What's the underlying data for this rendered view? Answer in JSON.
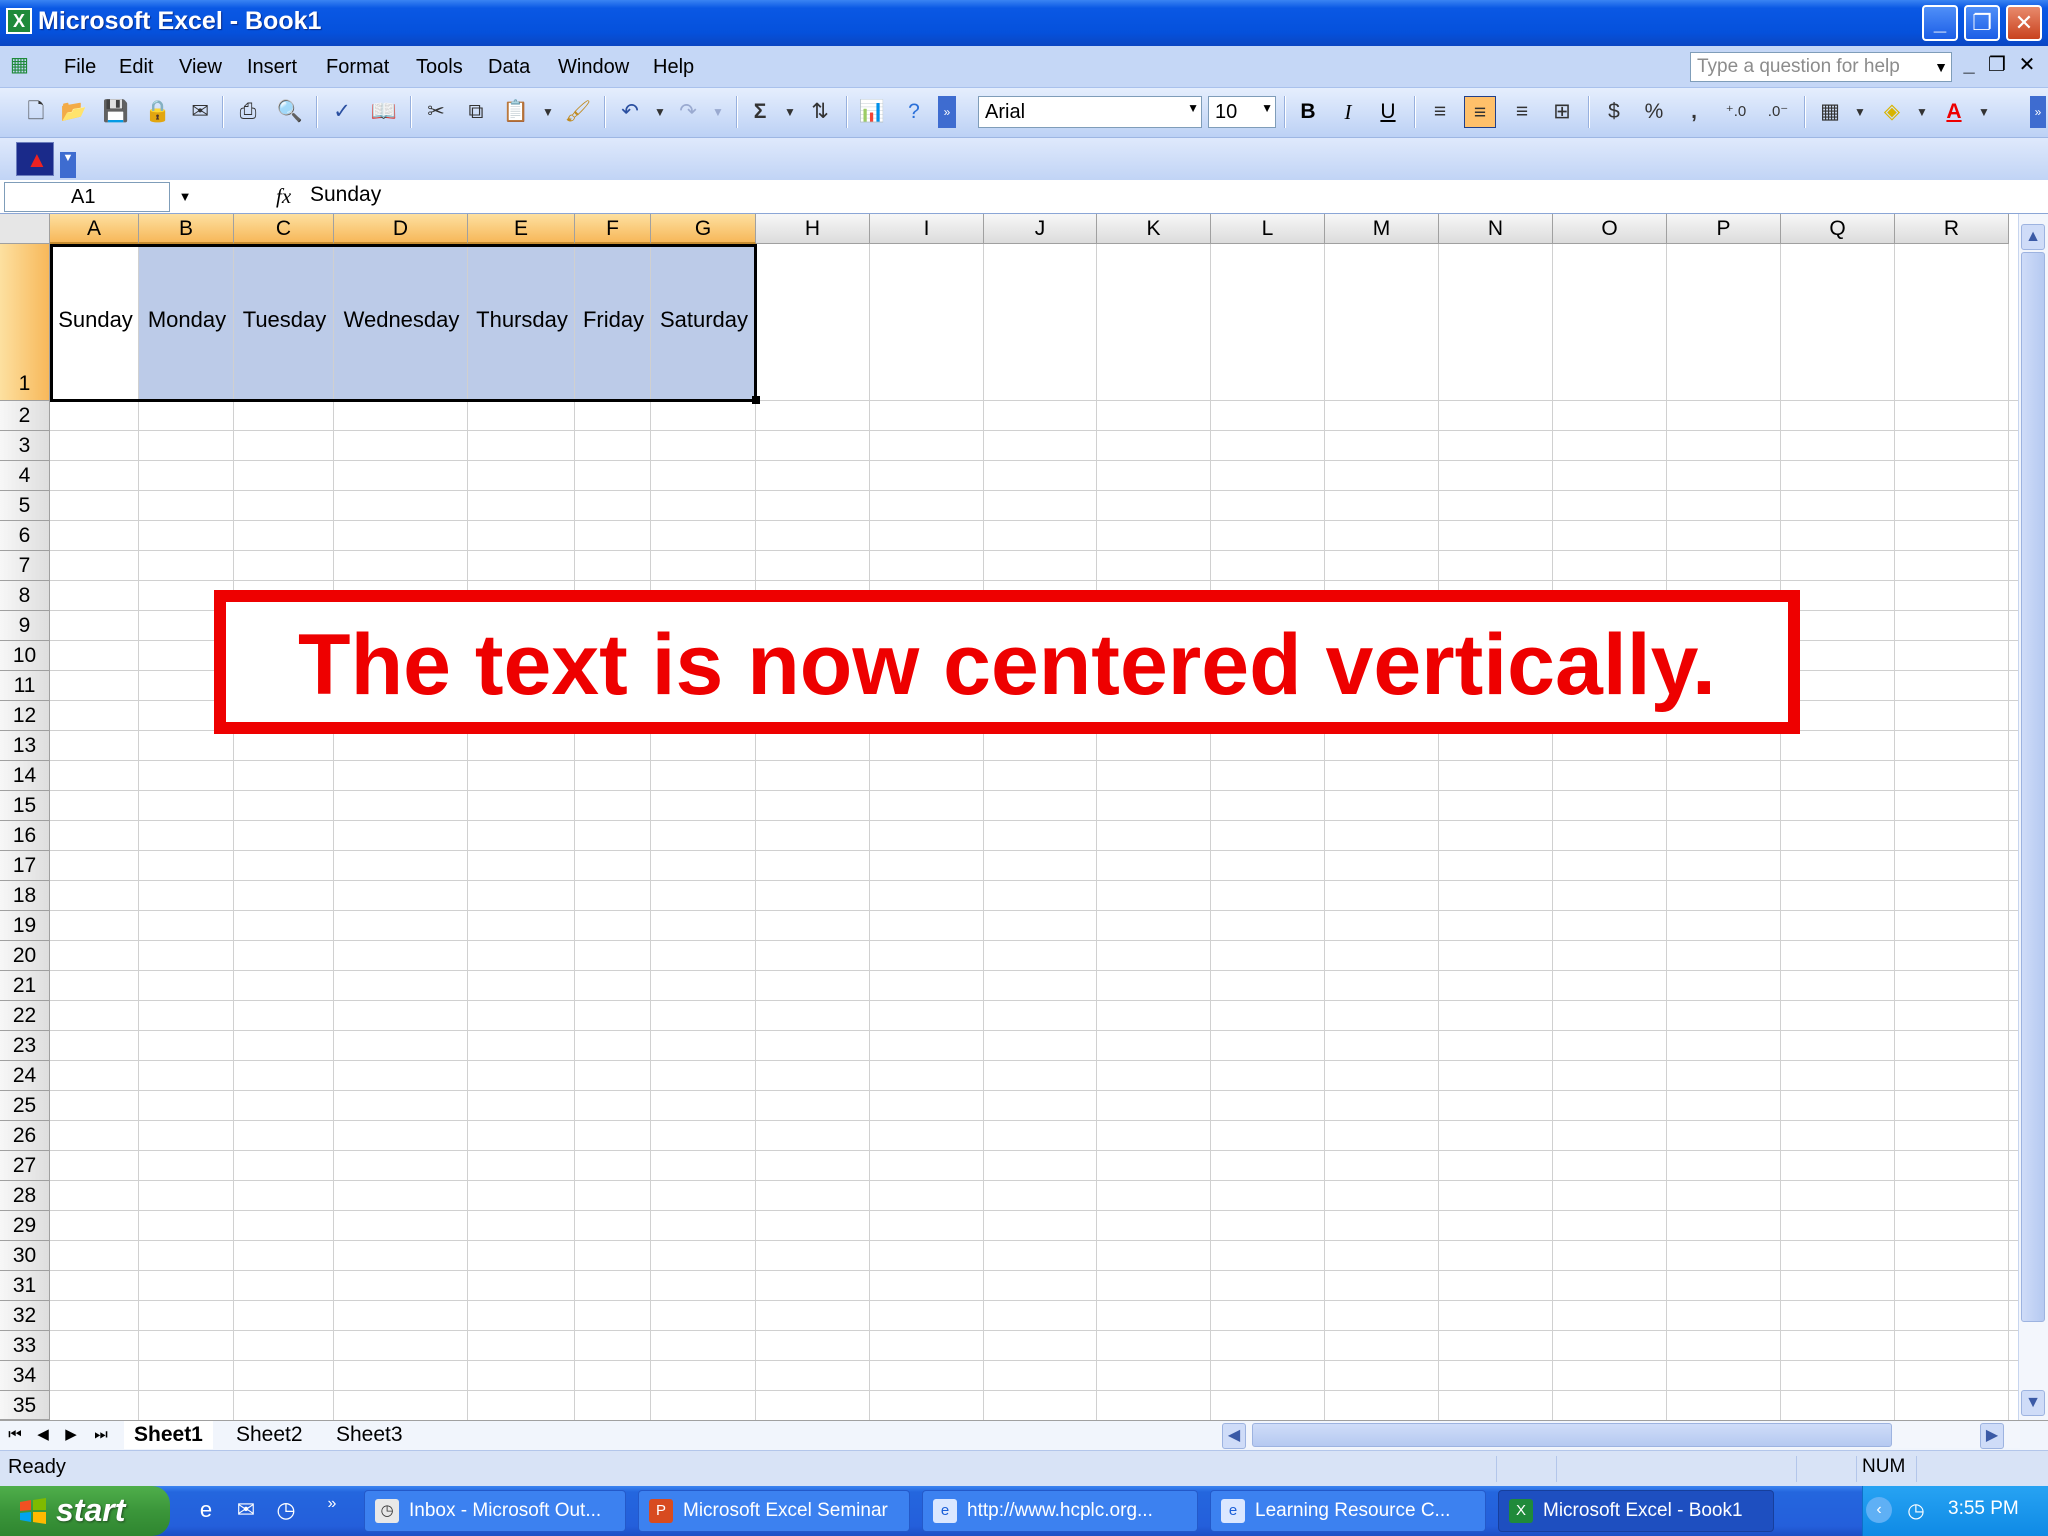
{
  "window": {
    "title": "Microsoft Excel - Book1"
  },
  "menu": {
    "items": [
      "File",
      "Edit",
      "View",
      "Insert",
      "Format",
      "Tools",
      "Data",
      "Window",
      "Help"
    ],
    "help_placeholder": "Type a question for help"
  },
  "toolbar": {
    "font_name": "Arial",
    "font_size": "10",
    "bold": "B",
    "italic": "I",
    "underline": "U",
    "currency": "$",
    "percent": "%",
    "comma": ",",
    "sum": "Σ"
  },
  "formula_bar": {
    "name_box": "A1",
    "fx": "fx",
    "value": "Sunday"
  },
  "sheet": {
    "columns": [
      "A",
      "B",
      "C",
      "D",
      "E",
      "F",
      "G",
      "H",
      "I",
      "J",
      "K",
      "L",
      "M",
      "N",
      "O",
      "P",
      "Q",
      "R"
    ],
    "rows": [
      "1",
      "2",
      "3",
      "4",
      "5",
      "6",
      "7",
      "8",
      "9",
      "10",
      "11",
      "12",
      "13",
      "14",
      "15",
      "16",
      "17",
      "18",
      "19",
      "20",
      "21",
      "22",
      "23",
      "24",
      "25",
      "26",
      "27",
      "28",
      "29",
      "30",
      "31",
      "32",
      "33",
      "34",
      "35"
    ],
    "row1": [
      "Sunday",
      "Monday",
      "Tuesday",
      "Wednesday",
      "Thursday",
      "Friday",
      "Saturday"
    ],
    "selected_range": "A1:G1"
  },
  "tabs": [
    "Sheet1",
    "Sheet2",
    "Sheet3"
  ],
  "status": {
    "text": "Ready",
    "num": "NUM"
  },
  "taskbar": {
    "start": "start",
    "tasks": [
      "Inbox - Microsoft Out...",
      "Microsoft Excel Seminar",
      "http://www.hcplc.org...",
      "Learning Resource C...",
      "Microsoft Excel - Book1"
    ],
    "clock": "3:55 PM"
  },
  "annotation": {
    "text": "The text is now centered vertically."
  },
  "colors": {
    "accent": "#0551dc",
    "selection": "#bccbe8",
    "annotation": "#ee0000",
    "header_selected": "#f7b85a"
  }
}
